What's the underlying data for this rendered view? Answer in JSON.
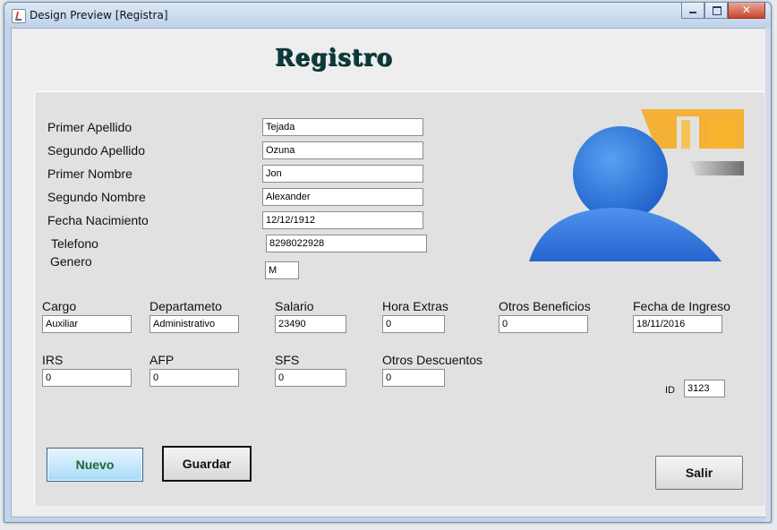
{
  "window": {
    "title": "Design Preview [Registra]"
  },
  "heading": "Registro",
  "form": {
    "primer_apellido": {
      "label": "Primer Apellido",
      "value": "Tejada"
    },
    "segundo_apellido": {
      "label": "Segundo Apellido",
      "value": "Ozuna"
    },
    "primer_nombre": {
      "label": "Primer Nombre",
      "value": "Jon"
    },
    "segundo_nombre": {
      "label": "Segundo Nombre",
      "value": "Alexander"
    },
    "fecha_nacimiento": {
      "label": "Fecha Nacimiento",
      "value": "12/12/1912"
    },
    "telefono": {
      "label": "Telefono",
      "value": "8298022928"
    },
    "genero": {
      "label": "Genero",
      "value": "M"
    },
    "cargo": {
      "label": "Cargo",
      "value": "Auxiliar"
    },
    "departamento": {
      "label": "Departameto",
      "value": "Administrativo"
    },
    "salario": {
      "label": "Salario",
      "value": "23490"
    },
    "hora_extras": {
      "label": "Hora Extras",
      "value": "0"
    },
    "otros_beneficios": {
      "label": "Otros Beneficios",
      "value": "0"
    },
    "fecha_ingreso": {
      "label": "Fecha de Ingreso",
      "value": "18/11/2016"
    },
    "irs": {
      "label": "IRS",
      "value": "0"
    },
    "afp": {
      "label": "AFP",
      "value": "0"
    },
    "sfs": {
      "label": "SFS",
      "value": "0"
    },
    "otros_descuentos": {
      "label": "Otros Descuentos",
      "value": "0"
    },
    "id": {
      "label": "ID",
      "value": "3123"
    }
  },
  "buttons": {
    "nuevo": "Nuevo",
    "guardar": "Guardar",
    "salir": "Salir"
  },
  "colors": {
    "logo_blue": "#2f73d8",
    "logo_orange": "#f4b135",
    "logo_gray": "#888888",
    "heading": "#0c3b3b",
    "nuevo_text": "#1b6a36"
  },
  "icons": {
    "logo": "user-silhouette-logo"
  }
}
